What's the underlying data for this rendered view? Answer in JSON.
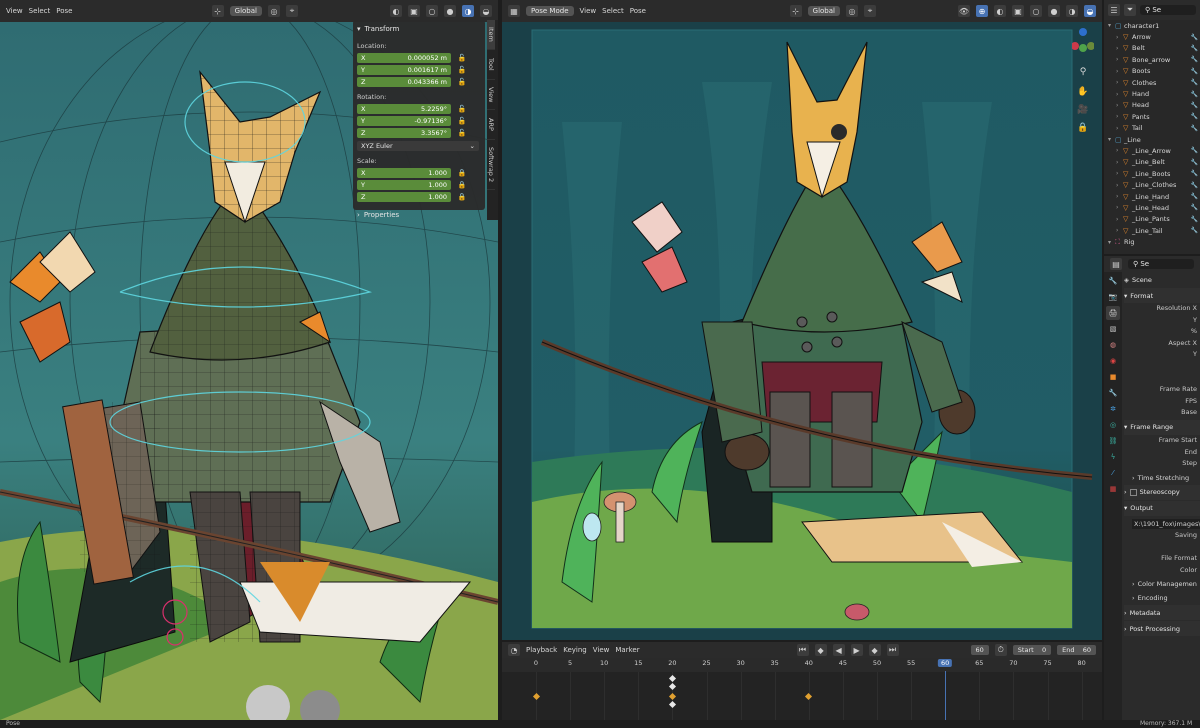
{
  "left_viewport": {
    "menu": [
      "View",
      "Select",
      "Pose"
    ],
    "orientation": "Global",
    "npanel": {
      "title": "Transform",
      "location_label": "Location:",
      "location": [
        {
          "axis": "X",
          "value": "0.000052 m"
        },
        {
          "axis": "Y",
          "value": "0.001617 m"
        },
        {
          "axis": "Z",
          "value": "0.043366 m"
        }
      ],
      "rotation_label": "Rotation:",
      "rotation": [
        {
          "axis": "X",
          "value": "5.2259°"
        },
        {
          "axis": "Y",
          "value": "-0.97136°"
        },
        {
          "axis": "Z",
          "value": "3.3567°"
        }
      ],
      "rotation_mode": "XYZ Euler",
      "scale_label": "Scale:",
      "scale": [
        {
          "axis": "X",
          "value": "1.000"
        },
        {
          "axis": "Y",
          "value": "1.000"
        },
        {
          "axis": "Z",
          "value": "1.000"
        }
      ],
      "properties": "Properties"
    },
    "tabs": [
      "Item",
      "Tool",
      "View",
      "ARP",
      "Softwrap 2"
    ]
  },
  "right_viewport": {
    "mode": "Pose Mode",
    "menu": [
      "View",
      "Select",
      "Pose"
    ],
    "orientation": "Global"
  },
  "timeline": {
    "menu": [
      "Playback",
      "Keying",
      "View",
      "Marker"
    ],
    "current_frame": "60",
    "start_label": "Start",
    "start": "0",
    "end_label": "End",
    "end": "60",
    "ticks": [
      "0",
      "5",
      "10",
      "15",
      "20",
      "25",
      "30",
      "35",
      "40",
      "45",
      "50",
      "55",
      "60",
      "65",
      "70",
      "75",
      "80"
    ],
    "keyframes": [
      0,
      20,
      40
    ]
  },
  "outliner": {
    "search_placeholder": "Se",
    "rows": [
      {
        "label": "character1",
        "indent": 0,
        "kind": "coll"
      },
      {
        "label": "Arrow",
        "indent": 1,
        "kind": "bone"
      },
      {
        "label": "Belt",
        "indent": 1,
        "kind": "bone"
      },
      {
        "label": "Bone_arrow",
        "indent": 1,
        "kind": "bone"
      },
      {
        "label": "Boots",
        "indent": 1,
        "kind": "bone"
      },
      {
        "label": "Clothes",
        "indent": 1,
        "kind": "bone"
      },
      {
        "label": "Hand",
        "indent": 1,
        "kind": "bone"
      },
      {
        "label": "Head",
        "indent": 1,
        "kind": "bone"
      },
      {
        "label": "Pants",
        "indent": 1,
        "kind": "bone"
      },
      {
        "label": "Tail",
        "indent": 1,
        "kind": "bone"
      },
      {
        "label": "_Line",
        "indent": 0,
        "kind": "coll"
      },
      {
        "label": "_Line_Arrow",
        "indent": 1,
        "kind": "bone"
      },
      {
        "label": "_Line_Belt",
        "indent": 1,
        "kind": "bone"
      },
      {
        "label": "_Line_Boots",
        "indent": 1,
        "kind": "bone"
      },
      {
        "label": "_Line_Clothes",
        "indent": 1,
        "kind": "bone"
      },
      {
        "label": "_Line_Hand",
        "indent": 1,
        "kind": "bone"
      },
      {
        "label": "_Line_Head",
        "indent": 1,
        "kind": "bone"
      },
      {
        "label": "_Line_Pants",
        "indent": 1,
        "kind": "bone"
      },
      {
        "label": "_Line_Tail",
        "indent": 1,
        "kind": "bone"
      },
      {
        "label": "Rig",
        "indent": 0,
        "kind": "rig"
      }
    ]
  },
  "properties": {
    "search_placeholder": "Se",
    "scene": "Scene",
    "format_header": "Format",
    "format_rows": [
      "Resolution X",
      "Y",
      "%",
      "Aspect X",
      "Y",
      "",
      "",
      "Frame Rate",
      "FPS",
      "Base"
    ],
    "frame_range_header": "Frame Range",
    "frame_range_rows": [
      "Frame Start",
      "End",
      "Step"
    ],
    "time_stretching": "Time Stretching",
    "stereoscopy": "Stereoscopy",
    "output_header": "Output",
    "output_path": "X:\\1901_fox\\images\\",
    "output_rows": [
      "Saving",
      "",
      "File Format",
      "Color"
    ],
    "color_management": "Color Managemen",
    "encoding": "Encoding",
    "metadata": "Metadata",
    "post_processing": "Post Processing"
  },
  "status": {
    "left": "Pose",
    "right": "Memory: 367.1 M"
  }
}
